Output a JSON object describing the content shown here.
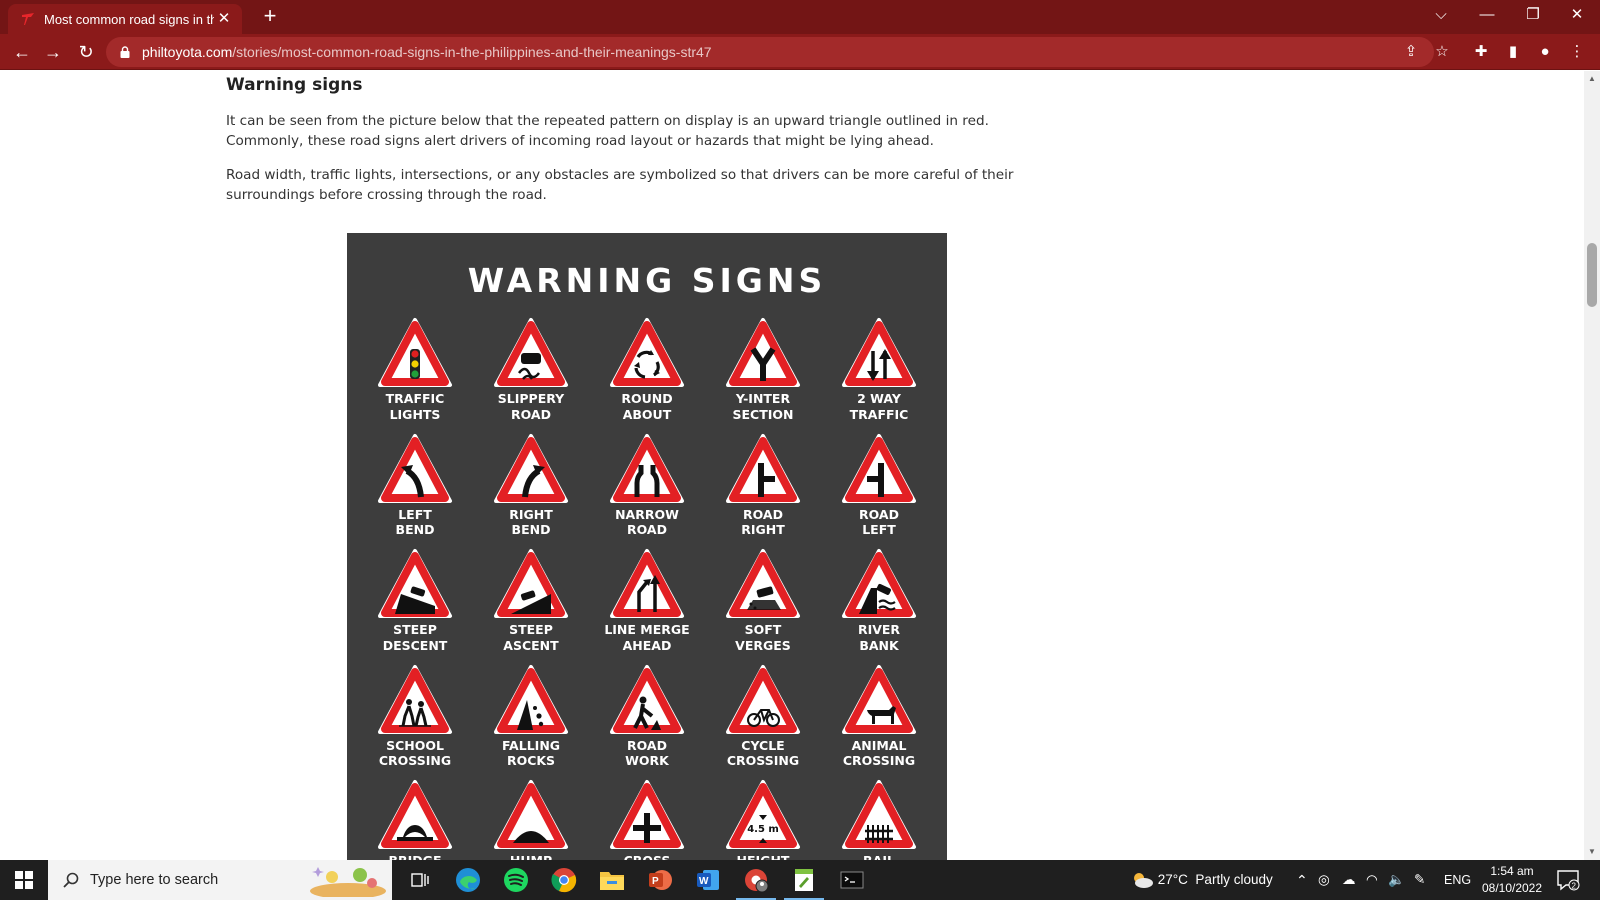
{
  "browser": {
    "tab_title": "Most common road signs in the Philippines and their meanings",
    "tab_close": "✕",
    "new_tab": "+",
    "url_host": "philtoyota.com",
    "url_path": "/stories/most-common-road-signs-in-the-philippines-and-their-meanings-str47",
    "accent_color": "#8b1a1a"
  },
  "article": {
    "heading": "Warning signs",
    "paragraphs": [
      "It can be seen from the picture below that the repeated pattern on display is an upward triangle outlined in red. Commonly, these road signs alert drivers of incoming road layout or hazards that might be lying ahead.",
      "Road width, traffic lights, intersections, or any obstacles are symbolized so that drivers can be more careful of their surroundings before crossing through the road."
    ]
  },
  "figure": {
    "title": "WARNING SIGNS",
    "signs": [
      {
        "label": "TRAFFIC\nLIGHTS",
        "icon": "traffic-lights-icon"
      },
      {
        "label": "SLIPPERY\nROAD",
        "icon": "slippery-road-icon"
      },
      {
        "label": "ROUND\nABOUT",
        "icon": "roundabout-icon"
      },
      {
        "label": "Y-INTER\nSECTION",
        "icon": "y-intersection-icon"
      },
      {
        "label": "2 WAY\nTRAFFIC",
        "icon": "two-way-traffic-icon"
      },
      {
        "label": "LEFT\nBEND",
        "icon": "left-bend-icon"
      },
      {
        "label": "RIGHT\nBEND",
        "icon": "right-bend-icon"
      },
      {
        "label": "NARROW\nROAD",
        "icon": "narrow-road-icon"
      },
      {
        "label": "ROAD\nRIGHT",
        "icon": "road-right-icon"
      },
      {
        "label": "ROAD\nLEFT",
        "icon": "road-left-icon"
      },
      {
        "label": "STEEP\nDESCENT",
        "icon": "steep-descent-icon"
      },
      {
        "label": "STEEP\nASCENT",
        "icon": "steep-ascent-icon"
      },
      {
        "label": "LINE MERGE\nAHEAD",
        "icon": "line-merge-icon"
      },
      {
        "label": "SOFT\nVERGES",
        "icon": "soft-verges-icon"
      },
      {
        "label": "RIVER\nBANK",
        "icon": "river-bank-icon"
      },
      {
        "label": "SCHOOL\nCROSSING",
        "icon": "school-crossing-icon"
      },
      {
        "label": "FALLING\nROCKS",
        "icon": "falling-rocks-icon"
      },
      {
        "label": "ROAD\nWORK",
        "icon": "road-work-icon"
      },
      {
        "label": "CYCLE\nCROSSING",
        "icon": "cycle-crossing-icon"
      },
      {
        "label": "ANIMAL\nCROSSING",
        "icon": "animal-crossing-icon"
      },
      {
        "label": "BRIDGE",
        "icon": "bridge-icon"
      },
      {
        "label": "HUMP",
        "icon": "hump-icon"
      },
      {
        "label": "CROSS",
        "icon": "cross-icon"
      },
      {
        "label": "HEIGHT",
        "icon": "height-icon",
        "sign_text": "4.5 m"
      },
      {
        "label": "RAIL",
        "icon": "rail-icon"
      }
    ]
  },
  "taskbar": {
    "search_placeholder": "Type here to search",
    "weather": "27°C  Partly cloudy",
    "language": "ENG",
    "time": "1:54 am",
    "date": "08/10/2022",
    "notification_count": "2"
  }
}
